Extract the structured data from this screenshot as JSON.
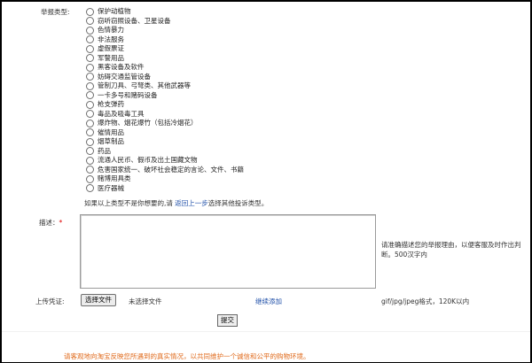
{
  "report_type": {
    "label": "举报类型:",
    "options": [
      "保护动植物",
      "窃听窃照设备、卫星设备",
      "色情暴力",
      "非法服务",
      "虚假票证",
      "军警用品",
      "黑客设备及软件",
      "妨碍交通监管设备",
      "管制刀具、弓弩类、其他武器等",
      "一卡多号和赌码设备",
      "枪支弹药",
      "毒品及吸毒工具",
      "爆炸物、烟花爆竹（包括冷烟花）",
      "催情用品",
      "烟草制品",
      "药品",
      "流通人民币、假币及出土国藏文物",
      "危害国家统一、破坏社会稳定的言论、文件、书籍",
      "赌博用具类",
      "医疗器械"
    ],
    "hint_prefix": "如果以上类型不是你想要的,请 ",
    "hint_link": "返回上一步",
    "hint_suffix": "选择其他投诉类型。"
  },
  "description": {
    "label": "描述：",
    "required_mark": "*",
    "value": "",
    "note": "请准确描述您的举报理由，以便客服及时作出判断。500汉字内"
  },
  "upload": {
    "label": "上传凭证:",
    "choose_button": "选择文件",
    "status": "未选择文件",
    "add_more": "继续添加",
    "format_note": "gif/jpg/jpeg格式，120K以内"
  },
  "submit_label": "提交",
  "footer_note": "请客观地向淘宝反映您所遇到的真实情况，以共同维护一个诚信和公平的购物环境。"
}
